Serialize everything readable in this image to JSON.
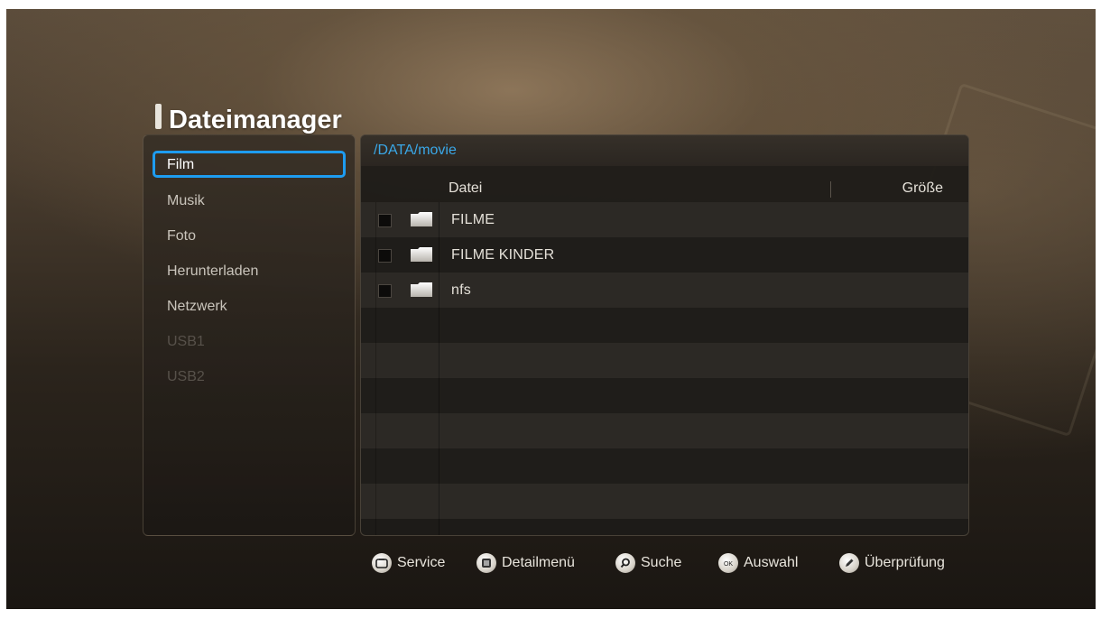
{
  "app": {
    "title": "Dateimanager"
  },
  "sidebar": {
    "items": [
      {
        "label": "Film",
        "state": "selected"
      },
      {
        "label": "Musik",
        "state": "normal"
      },
      {
        "label": "Foto",
        "state": "normal"
      },
      {
        "label": "Herunterladen",
        "state": "normal"
      },
      {
        "label": "Netzwerk",
        "state": "normal"
      },
      {
        "label": "USB1",
        "state": "disabled"
      },
      {
        "label": "USB2",
        "state": "disabled"
      }
    ]
  },
  "browser": {
    "path": "/DATA/movie",
    "columns": {
      "name": "Datei",
      "size": "Größe"
    },
    "files": [
      {
        "name": "FILME",
        "type": "folder",
        "checked": false
      },
      {
        "name": "FILME KINDER",
        "type": "folder",
        "checked": false
      },
      {
        "name": "nfs",
        "type": "folder",
        "checked": false
      }
    ]
  },
  "footer": {
    "buttons": [
      {
        "label": "Service",
        "icon": "service-button-icon"
      },
      {
        "label": "Detailmenü",
        "icon": "menu-button-icon"
      },
      {
        "label": "Suche",
        "icon": "search-button-icon"
      },
      {
        "label": "Auswahl",
        "icon": "ok-button-icon"
      },
      {
        "label": "Überprüfung",
        "icon": "pencil-button-icon"
      }
    ]
  },
  "colors": {
    "accent": "#1e9cf0",
    "path_text": "#3aa8e8"
  }
}
